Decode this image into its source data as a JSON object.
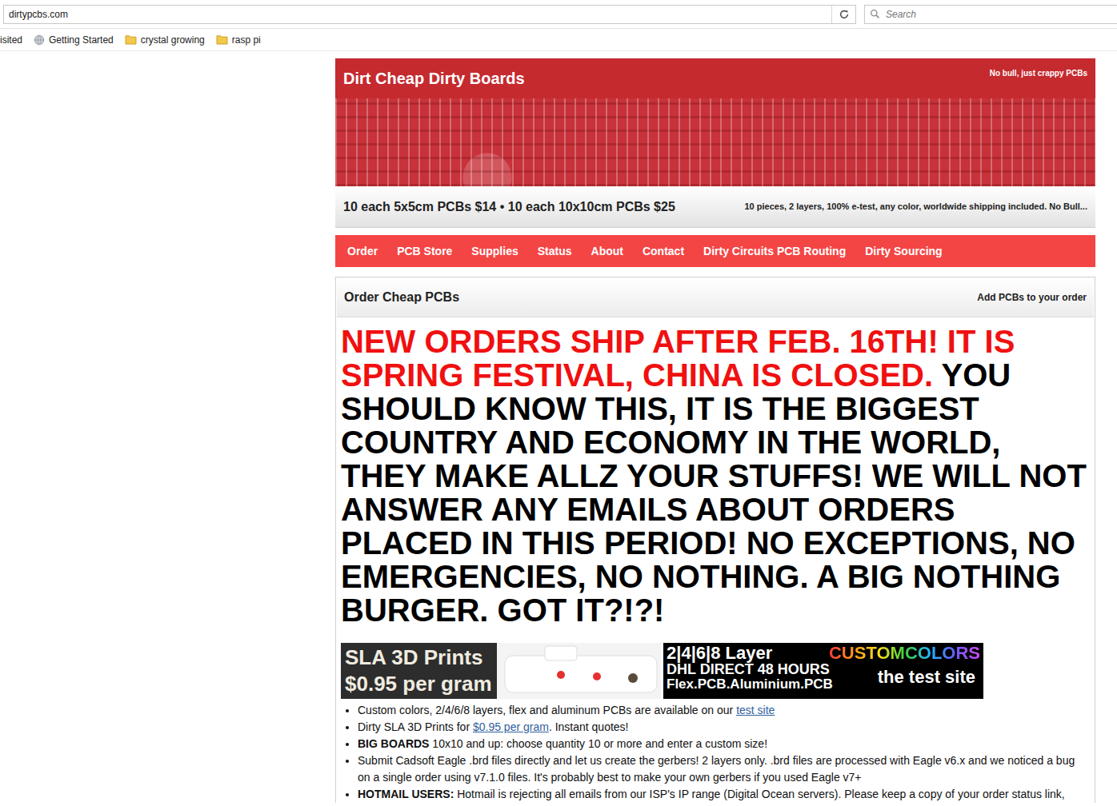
{
  "browser": {
    "address": "dirtypcbs.com",
    "search": {
      "placeholder": "Search"
    },
    "bookmarks": [
      {
        "label": "isited",
        "kind": "cut"
      },
      {
        "label": "Getting Started",
        "kind": "globe"
      },
      {
        "label": "crystal growing",
        "kind": "folder"
      },
      {
        "label": "rasp pi",
        "kind": "folder"
      }
    ]
  },
  "site": {
    "title": "Dirt Cheap Dirty Boards",
    "tagline": "No bull, just crappy PCBs",
    "offer": "10 each 5x5cm PCBs $14 • 10 each 10x10cm PCBs $25",
    "offer_details": "10 pieces, 2 layers, 100% e-test, any color, worldwide shipping included. No Bull...",
    "nav": [
      "Order",
      "PCB Store",
      "Supplies",
      "Status",
      "About",
      "Contact",
      "Dirty Circuits PCB Routing",
      "Dirty Sourcing"
    ]
  },
  "order_panel": {
    "title": "Order Cheap PCBs",
    "action": "Add PCBs to your order",
    "notice": [
      {
        "text": "NEW ORDERS SHIP AFTER FEB. 16TH! IT IS SPRING FESTIVAL, CHINA IS CLOSED.",
        "color": "#f01010"
      },
      {
        "text": " YOU SHOULD KNOW THIS, IT IS THE BIGGEST COUNTRY AND ECONOMY IN THE WORLD, THEY MAKE ALLZ YOUR STUFFS! WE WILL NOT ANSWER ANY EMAILS ABOUT ORDERS PLACED IN THIS PERIOD! NO EXCEPTIONS, NO EMERGENCIES, NO NOTHING. A BIG NOTHING BURGER. GOT IT?!?!",
        "color": "#000000"
      }
    ],
    "ads": [
      {
        "kind": "sla",
        "lines": [
          "SLA 3D Prints",
          "$0.95 per gram"
        ]
      },
      {
        "kind": "layers",
        "lines": [
          "2|4|6|8 Layer",
          "CUSTOMCOLORS",
          "DHL DIRECT 48 HOURS",
          "Flex.PCB.Aluminium.PCB",
          "the test site"
        ]
      }
    ],
    "bullets": [
      {
        "parts": [
          {
            "text": "Custom colors, 2/4/6/8 layers, flex and aluminum PCBs are available on our ",
            "kind": "plain"
          },
          {
            "text": "test site",
            "kind": "link"
          }
        ]
      },
      {
        "parts": [
          {
            "text": "Dirty SLA 3D Prints for ",
            "kind": "plain"
          },
          {
            "text": "$0.95 per gram",
            "kind": "link"
          },
          {
            "text": ". Instant quotes!",
            "kind": "plain"
          }
        ]
      },
      {
        "parts": [
          {
            "text": "BIG BOARDS",
            "kind": "bold"
          },
          {
            "text": " 10x10 and up: choose quantity 10 or more and enter a custom size!",
            "kind": "plain"
          }
        ]
      },
      {
        "parts": [
          {
            "text": "Submit Cadsoft Eagle .brd files directly and let us create the gerbers! 2 layers only. .brd files are processed with Eagle v6.x and we noticed a bug on a single order using v7.1.0 files. It's probably best to make your own gerbers if you used Eagle v7+",
            "kind": "plain"
          }
        ]
      },
      {
        "parts": [
          {
            "text": "HOTMAIL USERS:",
            "kind": "bold"
          },
          {
            "text": " Hotmail is rejecting all emails from our ISP's IP range (Digital Ocean servers). Please keep a copy of your order status link,",
            "kind": "plain"
          }
        ]
      }
    ]
  }
}
